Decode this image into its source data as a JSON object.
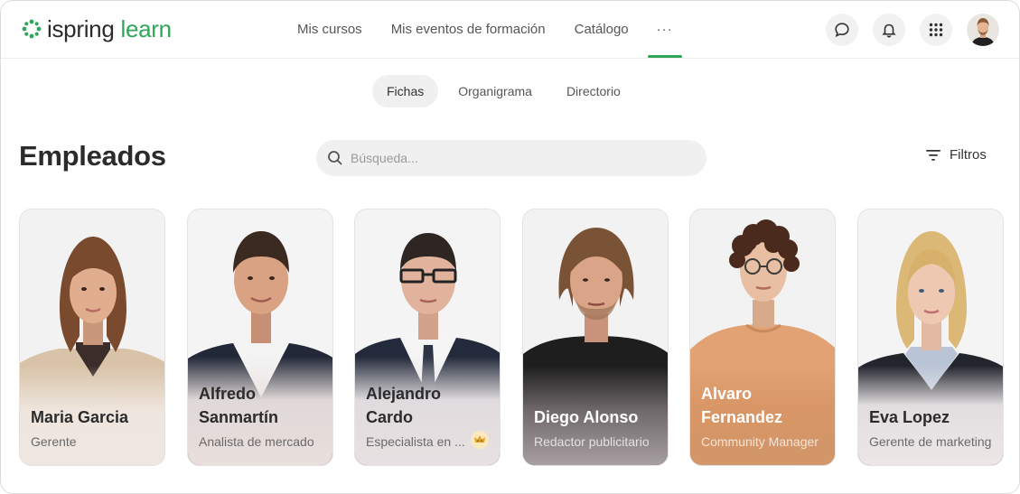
{
  "brand": {
    "name_part1": "ispring",
    "name_part2": "learn",
    "accent": "#2fa65a"
  },
  "nav": {
    "items": [
      "Mis cursos",
      "Mis eventos de formación",
      "Catálogo"
    ],
    "more_label": "···"
  },
  "header_icons": [
    "chat-icon",
    "bell-icon",
    "apps-grid-icon"
  ],
  "subtabs": {
    "items": [
      "Fichas",
      "Organigrama",
      "Directorio"
    ],
    "active": "Fichas"
  },
  "page": {
    "title": "Empleados",
    "search_placeholder": "Búsqueda...",
    "filters_label": "Filtros"
  },
  "employees": [
    {
      "name": "Maria Garcia",
      "role": "Gerente",
      "theme": "light"
    },
    {
      "name": "Alfredo Sanmartín",
      "role": "Analista de mercado",
      "theme": "light"
    },
    {
      "name": "Alejandro Cardo",
      "role": "Especialista en ...",
      "theme": "light",
      "badge": "crown-icon"
    },
    {
      "name": "Diego Alonso",
      "role": "Redactor publicitario",
      "theme": "dark"
    },
    {
      "name": "Alvaro Fernandez",
      "role": "Community Manager",
      "theme": "dark"
    },
    {
      "name": "Eva Lopez",
      "role": "Gerente de marketing",
      "theme": "light"
    }
  ]
}
